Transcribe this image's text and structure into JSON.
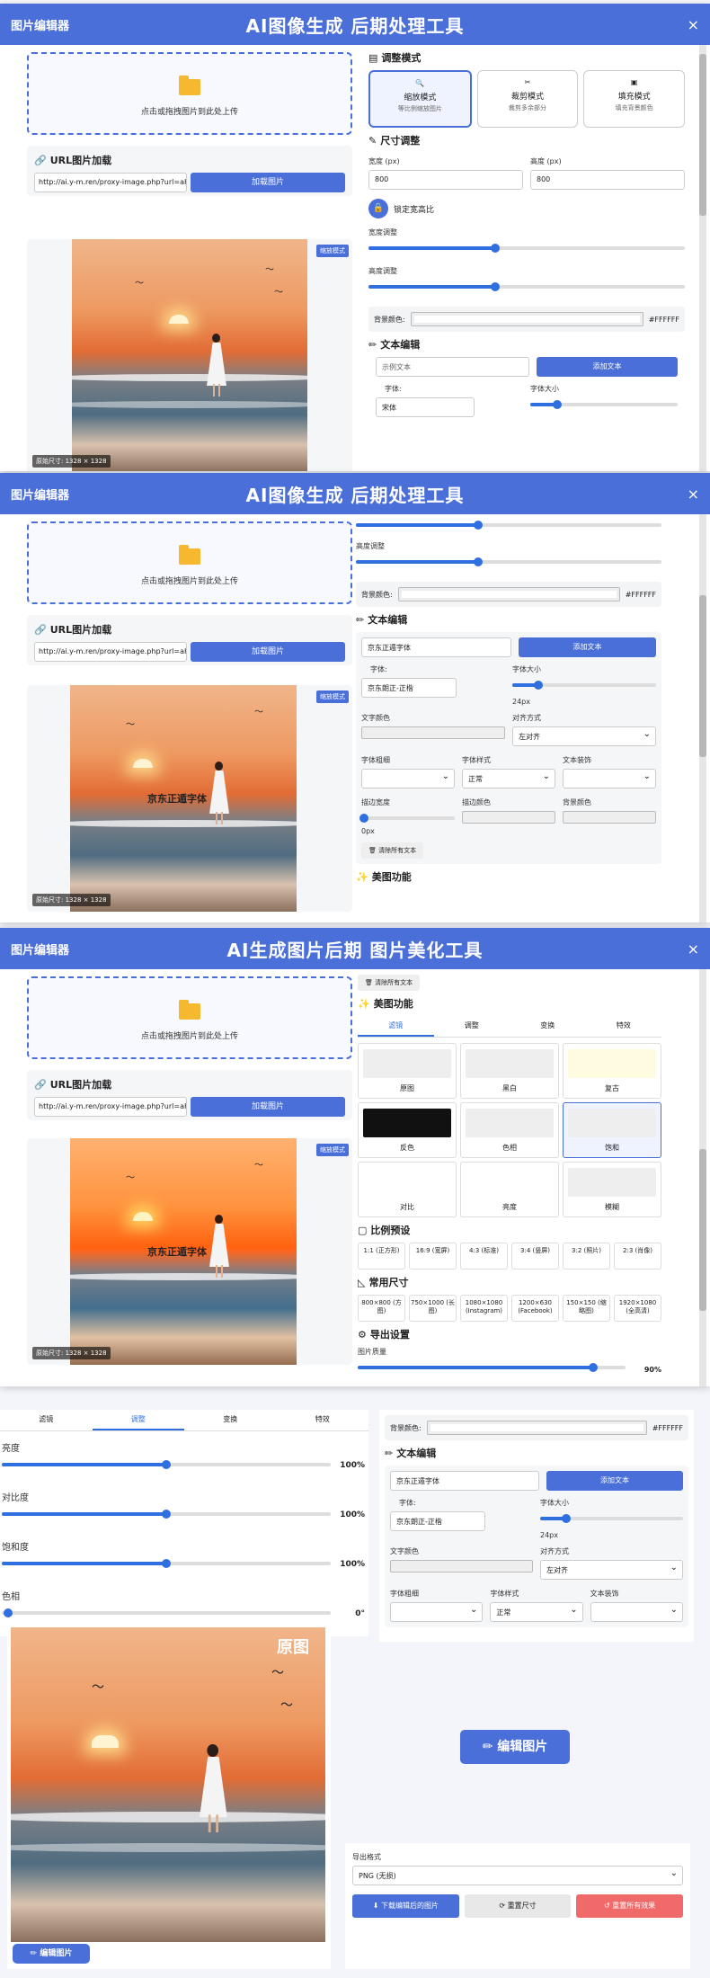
{
  "app": {
    "name": "图片编辑器",
    "title": "AI图像生成 后期处理工具",
    "title3": "AI生成图片后期 图片美化工具",
    "close": "×"
  },
  "upload": {
    "text": "点击或拖拽图片到此处上传"
  },
  "url": {
    "heading": "URL图片加载",
    "value": "http://ai.y-m.ren/proxy-image.php?url=aH",
    "button": "加载图片"
  },
  "preview": {
    "badge": "缩放模式",
    "dims": "原始尺寸: 1328 × 1328",
    "overlay": "京东正遁字体",
    "original": "原图"
  },
  "adjust_mode": {
    "heading": "调整模式",
    "modes": [
      {
        "title": "缩放模式",
        "sub": "等比例缩放图片"
      },
      {
        "title": "裁剪模式",
        "sub": "裁剪多余部分"
      },
      {
        "title": "填充模式",
        "sub": "填充背景颜色"
      }
    ]
  },
  "size": {
    "heading": "尺寸调整",
    "width_label": "宽度 (px)",
    "height_label": "高度 (px)",
    "width": "800",
    "height": "800",
    "lock": "锁定宽高比",
    "wslider": "宽度调整",
    "hslider": "高度调整"
  },
  "bg": {
    "label": "背景颜色:",
    "value": "#FFFFFF"
  },
  "text": {
    "heading": "文本编辑",
    "placeholder": "示例文本",
    "value": "京东正遁字体",
    "add": "添加文本",
    "font_label": "字体:",
    "font_default": "宋体",
    "font_value": "京东朗正-正楷",
    "size_label": "字体大小",
    "size_value": "24px",
    "color_label": "文字颜色",
    "align_label": "对齐方式",
    "align_value": "左对齐",
    "weight_label": "字体粗细",
    "style_label": "字体样式",
    "style_value": "正常",
    "decor_label": "文本装饰",
    "stroke_w": "描边宽度",
    "stroke_c": "描边颜色",
    "bg_c": "背景颜色",
    "stroke_val": "0px",
    "clear": "清除所有文本"
  },
  "beauty": {
    "heading": "美图功能",
    "tabs": [
      "滤镜",
      "调整",
      "变换",
      "特效"
    ],
    "filters": [
      {
        "n": "原图",
        "c": "#eeeeee"
      },
      {
        "n": "黑白",
        "c": "#eeeeee"
      },
      {
        "n": "复古",
        "c": "#fffbe0"
      },
      {
        "n": "反色",
        "c": "#111111"
      },
      {
        "n": "色相",
        "c": "#eeeeee"
      },
      {
        "n": "饱和",
        "c": "#eeeeee"
      },
      {
        "n": "对比",
        "c": "#ffffff"
      },
      {
        "n": "亮度",
        "c": "#ffffff"
      },
      {
        "n": "模糊",
        "c": "#eeeeee"
      }
    ]
  },
  "ratio": {
    "heading": "比例预设",
    "items": [
      "1:1 (正方形)",
      "16:9 (宽屏)",
      "4:3 (标准)",
      "3:4 (竖屏)",
      "3:2 (照片)",
      "2:3 (肖像)"
    ]
  },
  "common": {
    "heading": "常用尺寸",
    "items": [
      "800×800 (方图)",
      "750×1000 (长图)",
      "1080×1080 (Instagram)",
      "1200×630 (Facebook)",
      "150×150 (缩略图)",
      "1920×1080 (全高清)"
    ]
  },
  "export": {
    "heading": "导出设置",
    "quality": "图片质量",
    "quality_val": "90%",
    "format_label": "导出格式",
    "format": "PNG (无损)",
    "download": "下载编辑后的图片",
    "reset_size": "重置尺寸",
    "reset_all": "重置所有效果"
  },
  "adjust": {
    "brightness": "亮度",
    "contrast": "对比度",
    "saturation": "饱和度",
    "hue": "色相",
    "v100": "100%",
    "v0": "0°"
  },
  "edit_button": "编辑图片"
}
